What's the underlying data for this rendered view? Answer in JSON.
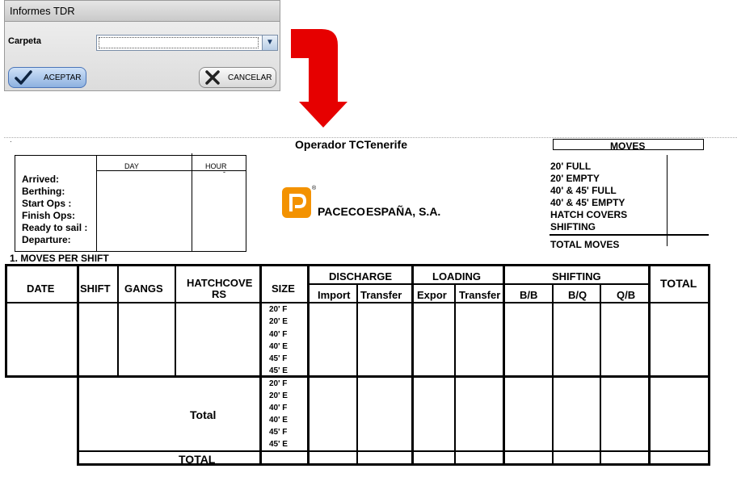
{
  "dialog": {
    "title": "Informes TDR",
    "field_label": "Carpeta",
    "field_value": "",
    "dropdown_glyph": "▼",
    "accept_label": "ACEPTAR",
    "cancel_label": "CANCELAR",
    "accept_icon": "checkmark-icon",
    "cancel_icon": "x-icon"
  },
  "arrow": {
    "color": "#e60000"
  },
  "report": {
    "operator_title": "Operador  TCTenerife",
    "arrival_table": {
      "headers": [
        "DAY",
        "HOUR"
      ],
      "hour_value": "-",
      "rows": [
        "Arrived:",
        "Berthing:",
        "Start Ops :",
        "Finish Ops:",
        "Ready to sail :",
        "Departure:"
      ]
    },
    "logo": {
      "company": "PACECO",
      "country": "ESPAÑA, S.A.",
      "color": "#f39200",
      "registered": "®"
    },
    "moves_summary": {
      "title": "MOVES",
      "items": [
        "20' FULL",
        "20' EMPTY",
        "40' & 45' FULL",
        "40' & 45' EMPTY",
        "HATCH COVERS",
        "SHIFTING"
      ],
      "total_label": "TOTAL MOVES"
    },
    "section_title": "1. MOVES PER SHIFT",
    "shift_table": {
      "columns": {
        "date": "DATE",
        "shift": "SHIFT",
        "gangs": "GANGS",
        "hatch_line1": "HATCHCOVE",
        "hatch_line2": "RS",
        "size": "SIZE",
        "total": "TOTAL"
      },
      "groups": {
        "discharge": "DISCHARGE",
        "loading": "LOADING",
        "shifting": "SHIFTING"
      },
      "subcolumns": {
        "import": "Import",
        "transfer_d": "Transfer",
        "export": "Expor",
        "transfer_l": "Transfer",
        "bb": "B/B",
        "bq": "B/Q",
        "qb": "Q/B"
      },
      "sizes": [
        "20' F",
        "20' E",
        "40' F",
        "40' E",
        "45' F",
        "45' E"
      ],
      "total_row_label": "Total",
      "grand_total_label": "TOTAL"
    }
  }
}
